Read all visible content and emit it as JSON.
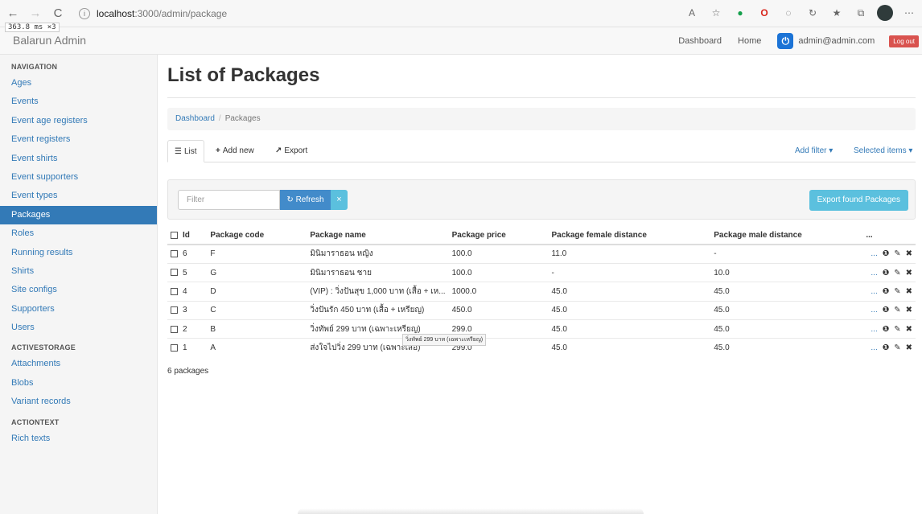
{
  "browser": {
    "url_host": "localhost",
    "url_path": ":3000/admin/package",
    "nav": {
      "back": "←",
      "forward": "→",
      "reload": "C"
    }
  },
  "perf_badge": "363.8 ms ×3",
  "header": {
    "brand": "Balarun Admin",
    "links": [
      "Dashboard",
      "Home"
    ],
    "user_email": "admin@admin.com",
    "logout_label": "Log out"
  },
  "sidebar": {
    "sections": [
      {
        "heading": "NAVIGATION",
        "items": [
          "Ages",
          "Events",
          "Event age registers",
          "Event registers",
          "Event shirts",
          "Event supporters",
          "Event types",
          "Packages",
          "Roles",
          "Running results",
          "Shirts",
          "Site configs",
          "Supporters",
          "Users"
        ]
      },
      {
        "heading": "ACTIVESTORAGE",
        "items": [
          "Attachments",
          "Blobs",
          "Variant records"
        ]
      },
      {
        "heading": "ACTIONTEXT",
        "items": [
          "Rich texts"
        ]
      }
    ],
    "active_item": "Packages"
  },
  "main": {
    "title": "List of Packages",
    "breadcrumb": {
      "link": "Dashboard",
      "separator": "/",
      "current": "Packages"
    },
    "tabs": {
      "list": "List",
      "add_new": "Add new",
      "export": "Export",
      "add_filter": "Add filter ▾",
      "selected_items": "Selected items ▾"
    },
    "filter": {
      "placeholder": "Filter",
      "refresh": "Refresh",
      "clear": "×",
      "export_found": "Export found Packages"
    },
    "table": {
      "headers": [
        "Id",
        "Package code",
        "Package name",
        "Package price",
        "Package female distance",
        "Package male distance",
        "..."
      ],
      "rows": [
        {
          "id": "6",
          "code": "F",
          "name": "มินิมาราธอน หญิง",
          "price": "100.0",
          "female": "11.0",
          "male": "-"
        },
        {
          "id": "5",
          "code": "G",
          "name": "มินิมาราธอน ชาย",
          "price": "100.0",
          "female": "-",
          "male": "10.0"
        },
        {
          "id": "4",
          "code": "D",
          "name": "(VIP) : วิ่งปันสุข 1,000 บาท (เสื้อ + เห...",
          "price": "1000.0",
          "female": "45.0",
          "male": "45.0"
        },
        {
          "id": "3",
          "code": "C",
          "name": "วิ่งปันรัก 450 บาท (เสื้อ + เหรียญ)",
          "price": "450.0",
          "female": "45.0",
          "male": "45.0"
        },
        {
          "id": "2",
          "code": "B",
          "name": "วิ่งทัพย์ 299 บาท (เฉพาะเหรียญ)",
          "price": "299.0",
          "female": "45.0",
          "male": "45.0"
        },
        {
          "id": "1",
          "code": "A",
          "name": "ส่งใจไปวิ่ง 299 บาท (เฉพาะเสื้อ)",
          "price": "299.0",
          "female": "45.0",
          "male": "45.0"
        }
      ],
      "row_actions": {
        "more": "...",
        "info": "❶",
        "edit": "✎",
        "delete": "✖"
      }
    },
    "tooltip": "วิ่งทัพย์ 299 บาท (เฉพาะเหรียญ)",
    "count": "6 packages"
  }
}
